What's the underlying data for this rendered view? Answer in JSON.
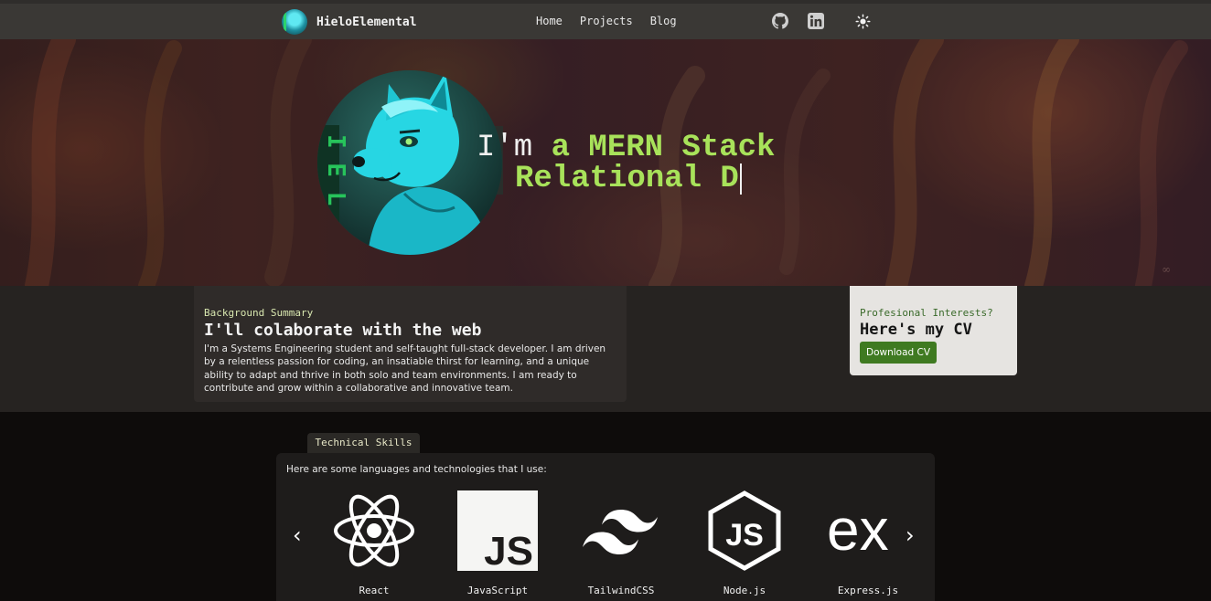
{
  "nav": {
    "brand": "HieloElemental",
    "links": [
      "Home",
      "Projects",
      "Blog"
    ],
    "icons": [
      "github-icon",
      "linkedin-icon",
      "sun-icon"
    ]
  },
  "hero": {
    "prefix": "I'm ",
    "line1_highlight": "a MERN Stack",
    "line2": "Relational D"
  },
  "background": {
    "eyebrow": "Background Summary",
    "title": "I'll colaborate with the web",
    "body": "I'm a Systems Engineering student and self-taught full-stack developer. I am driven by a relentless passion for coding, an insatiable thirst for learning, and a unique ability to adapt and thrive in both solo and team environments. I am ready to contribute and grow within a collaborative and innovative team."
  },
  "cv": {
    "eyebrow": "Profesional Interests?",
    "title": "Here's my CV",
    "button": "Download CV"
  },
  "skills": {
    "tab": "Technical Skills",
    "intro": "Here are some languages and technologies that I use:",
    "items": [
      {
        "name": "React",
        "icon": "react-icon"
      },
      {
        "name": "JavaScript",
        "icon": "javascript-icon"
      },
      {
        "name": "TailwindCSS",
        "icon": "tailwindcss-icon"
      },
      {
        "name": "Node.js",
        "icon": "nodejs-icon"
      },
      {
        "name": "Express.js",
        "icon": "express-icon"
      }
    ],
    "prev": "‹",
    "next": "›"
  },
  "colors": {
    "accent_green": "#a8e25a",
    "button_green": "#3f7a21"
  }
}
